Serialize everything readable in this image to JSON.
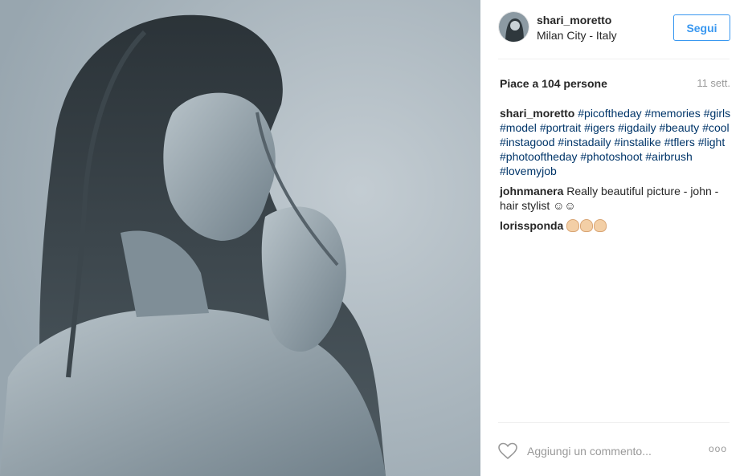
{
  "post": {
    "username": "shari_moretto",
    "location": "Milan City - Italy",
    "follow_label": "Segui",
    "likes": "Piace a 104 persone",
    "time": "11 sett."
  },
  "caption": {
    "user": "shari_moretto",
    "tags": [
      "#picoftheday",
      "#memories",
      "#girls",
      "#model",
      "#portrait",
      "#igers",
      "#igdaily",
      "#beauty",
      "#cool",
      "#instagood",
      "#instadaily",
      "#instalike",
      "#tflers",
      "#light",
      "#photooftheday",
      "#photoshoot",
      "#airbrush",
      "#lovemyjob"
    ]
  },
  "comments": [
    {
      "user": "johnmanera",
      "text": "Really beautiful picture - john - hair stylist ☺☺"
    },
    {
      "user": "lorissponda",
      "emoji": [
        "clapping-hands",
        "clapping-hands",
        "clapping-hands"
      ]
    }
  ],
  "footer": {
    "comment_placeholder": "Aggiungi un commento...",
    "more_label": "ooo"
  },
  "icons": [
    "heart-icon",
    "more-options-icon"
  ],
  "colors": {
    "accent": "#3897f0",
    "hashtag": "#003569",
    "muted": "#999999",
    "photo_tone": "#a7b3bb"
  }
}
